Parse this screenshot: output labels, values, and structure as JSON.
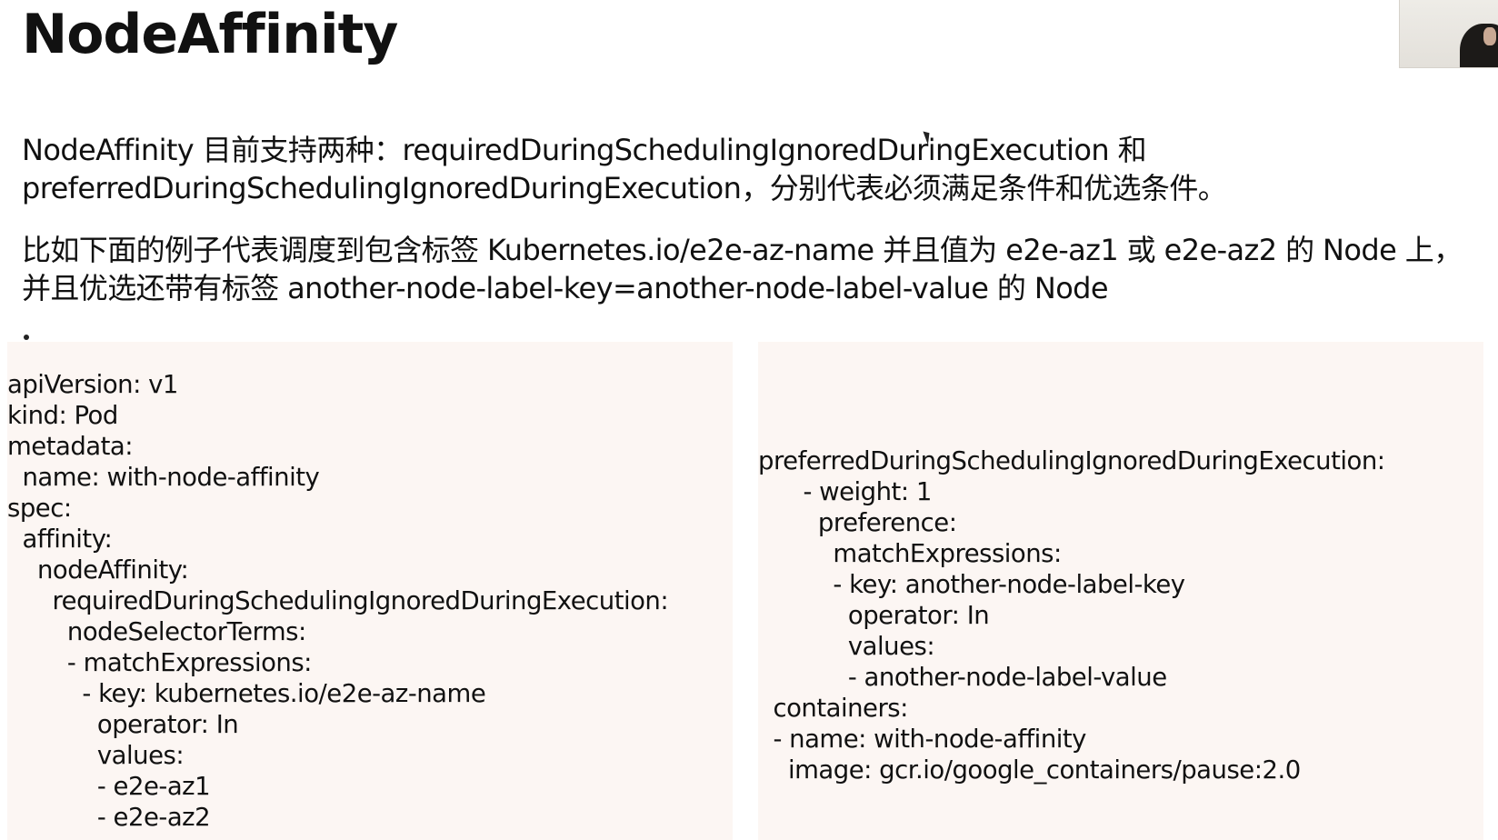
{
  "slide": {
    "title": "NodeAffinity",
    "paragraph_1": "NodeAffinity 目前支持两种：requiredDuringSchedulingIgnoredDuringExecution 和 preferredDuringSchedulingIgnoredDuringExecution，分别代表必须满足条件和优选条件。",
    "paragraph_2": "比如下面的例子代表调度到包含标签 Kubernetes.io/e2e-az-name 并且值为 e2e-az1 或 e2e-az2 的 Node 上，并且优选还带有标签 another-node-label-key=another-node-label-value 的 Node"
  },
  "code_left": {
    "lines": [
      "apiVersion: v1",
      "kind: Pod",
      "metadata:",
      "  name: with-node-affinity",
      "spec:",
      "  affinity:",
      "    nodeAffinity:",
      "      requiredDuringSchedulingIgnoredDuringExecution:",
      "        nodeSelectorTerms:",
      "        - matchExpressions:",
      "          - key: kubernetes.io/e2e-az-name",
      "            operator: In",
      "            values:",
      "            - e2e-az1",
      "            - e2e-az2"
    ]
  },
  "code_right": {
    "lines": [
      "preferredDuringSchedulingIgnoredDuringExecution:",
      "      - weight: 1",
      "        preference:",
      "          matchExpressions:",
      "          - key: another-node-label-key",
      "            operator: In",
      "            values:",
      "            - another-node-label-value",
      "  containers:",
      "  - name: with-node-affinity",
      "    image: gcr.io/google_containers/pause:2.0"
    ]
  },
  "colors": {
    "code_background": "#fcf6f3",
    "text": "#111111",
    "page_background": "#ffffff"
  },
  "icons": {
    "cursor": "mouse-cursor-icon",
    "presenter": "presenter-video-thumbnail"
  }
}
